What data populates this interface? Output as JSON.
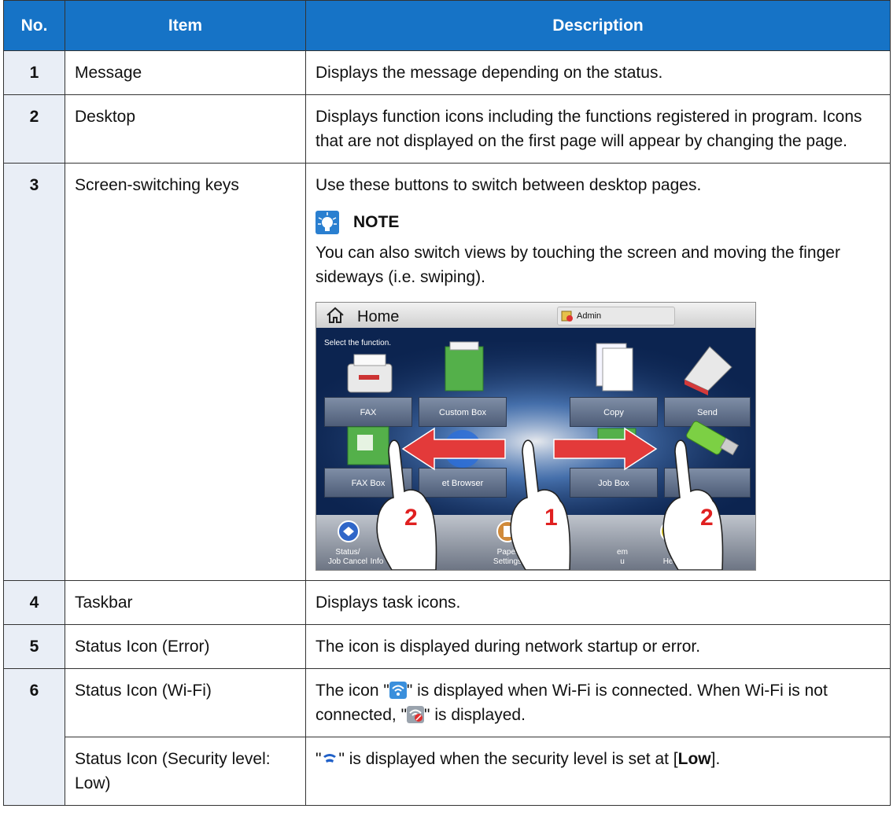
{
  "headers": {
    "no": "No.",
    "item": "Item",
    "description": "Description"
  },
  "rows": [
    {
      "no": "1",
      "item": "Message",
      "description": "Displays the message depending on the status."
    },
    {
      "no": "2",
      "item": "Desktop",
      "description": "Displays function icons including the functions registered in program. Icons that are not displayed on the first page will appear by changing the page."
    },
    {
      "no": "3",
      "item": "Screen-switching keys",
      "description": "Use these buttons to switch between desktop pages."
    },
    {
      "no": "4",
      "item": "Taskbar",
      "description": "Displays task icons."
    },
    {
      "no": "5",
      "item": "Status Icon (Error)",
      "description": "The icon is displayed during network startup or error."
    },
    {
      "no": "6",
      "item": "Status Icon (Wi-Fi)",
      "desc_part1": "The icon \"",
      "desc_part2": "\" is displayed when Wi-Fi is connected. When Wi-Fi is not connected, \"",
      "desc_part3": "\" is displayed."
    },
    {
      "item": "Status Icon (Security level: Low)",
      "desc_part1": "\"",
      "desc_part2": "\" is displayed when the security level is set at [",
      "desc_bold": "Low",
      "desc_part3": "]."
    }
  ],
  "note": {
    "title": "NOTE",
    "text": "You can also switch views by touching the screen and moving the finger sideways (i.e. swiping)."
  },
  "screenshot": {
    "title": "Home",
    "user": "Admin",
    "message": "Select the function.",
    "buttons_row1": [
      "FAX",
      "Custom Box",
      "Copy",
      "Send"
    ],
    "buttons_row2": [
      "FAX Box",
      "et Browser",
      "Job Box"
    ],
    "taskbar": [
      "Status/\nJob Cancel",
      "Info",
      "Paper\nSettings",
      "em\nu",
      "Help"
    ],
    "gesture_labels": [
      "2",
      "1",
      "2"
    ]
  },
  "colors": {
    "header_bg": "#1673c6",
    "no_col_bg": "#e9eef6",
    "arrow": "#e33a3a",
    "label_red": "#e02020"
  }
}
